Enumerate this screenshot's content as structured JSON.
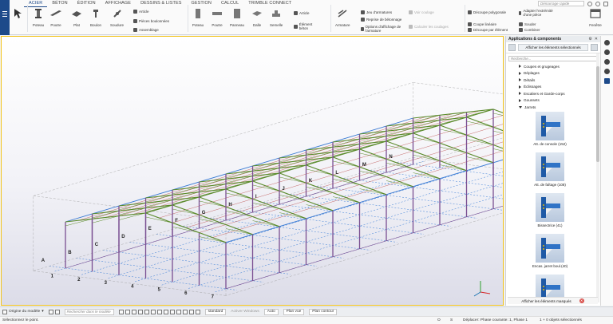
{
  "ribbon": {
    "tabs": [
      "ACIER",
      "BÉTON",
      "ÉDITION",
      "AFFICHAGE",
      "DESSINS & LISTES",
      "GESTION",
      "CALCUL",
      "TRIMBLE CONNECT"
    ],
    "active_tab": 0,
    "search_placeholder": "Démarrage rapide",
    "steel": {
      "poteau": "Poteau",
      "poutre": "Poutre",
      "plat": "Plat",
      "boulon": "Boulon",
      "soudure": "Soudure",
      "article": "Article",
      "pieces_boulonnees": "Pièces boulonnées",
      "assemblage": "Assemblage"
    },
    "concrete": {
      "poteau": "Poteau",
      "poutre": "Poutre",
      "panneau": "Panneau",
      "dalle": "Dalle",
      "semelle": "Semelle",
      "article": "Article",
      "element_beton": "Élément béton",
      "armature": "Armature",
      "jeu_armatures": "Jeu d'armatures",
      "reprise_betonnage": "Reprise de bétonnage",
      "options_affichage": "Options d'affichage de l'armature",
      "voir_coulage": "Voir coulage",
      "calculer_coulages": "Calculer les coulages"
    },
    "edit": {
      "decoupe_polygonale": "Découpe polygonale",
      "coupe_lineaire": "Coupe linéaire",
      "decoupe_par_element": "Découpe par élément",
      "adapter": "Adapter l'extrémité d'une pièce",
      "souder": "Souder",
      "combiner": "Combiner",
      "fenetre": "Fenêtre"
    }
  },
  "model": {
    "grid_letters": [
      "A",
      "B",
      "C",
      "D",
      "E",
      "F",
      "G",
      "H",
      "I",
      "J",
      "K",
      "L",
      "M",
      "N"
    ],
    "grid_numbers": [
      "1",
      "2",
      "3",
      "4",
      "5",
      "6",
      "7"
    ],
    "steel_color": "#7a4f92",
    "purlin_color": "#c05a5a",
    "truss_color": "#5a8a2a",
    "axis_color": "#3a7ed8"
  },
  "panel": {
    "title": "Applications & components",
    "show_selected": "Afficher les éléments sélectionnés",
    "search_placeholder": "Recherche...",
    "tree": [
      {
        "label": "Coupes et grugeages",
        "open": false
      },
      {
        "label": "Déplages",
        "open": false
      },
      {
        "label": "Détails",
        "open": false
      },
      {
        "label": "Éclissages",
        "open": false
      },
      {
        "label": "Escaliers et Garde-corps",
        "open": false
      },
      {
        "label": "Goussets",
        "open": false
      },
      {
        "label": "Jarrets",
        "open": true
      }
    ],
    "components": [
      {
        "label": "Att. de console (152)"
      },
      {
        "label": "Att. de faîtage (108)"
      },
      {
        "label": "Bissectrice (41)"
      },
      {
        "label": "Encas. jarret boul.(40)"
      },
      {
        "label": ""
      }
    ],
    "show_hidden": "Afficher les éléments masqués"
  },
  "status": {
    "origin": "Origine du modèle",
    "search_placeholder": "Rechercher dans le modèle",
    "standard": "standard",
    "auto": "Auto",
    "plan_vue": "Plan vue",
    "plan_contour": "Plan contour",
    "watermark": "Activer Windows"
  },
  "bottom": {
    "message": "Sélectionnez le point.",
    "o": "O",
    "s": "S",
    "phase": "Déplacer: Phase courante: 1, Phase 1",
    "selection": "1 + 0 objets sélectionnés"
  }
}
